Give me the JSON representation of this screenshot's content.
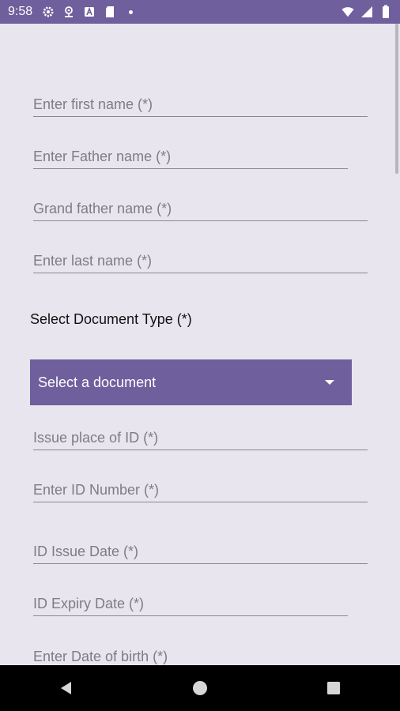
{
  "status_bar": {
    "time": "9:58",
    "left_icons": [
      "gear-icon",
      "location-icon",
      "a-box-icon",
      "sd-card-icon",
      "dot-icon"
    ],
    "right_icons": [
      "wifi-icon",
      "signal-icon",
      "battery-icon"
    ]
  },
  "form": {
    "first_name": {
      "placeholder": "Enter first name (*)",
      "value": ""
    },
    "father_name": {
      "placeholder": "Enter Father name (*)",
      "value": ""
    },
    "grandfather_name": {
      "placeholder": "Grand father name (*)",
      "value": ""
    },
    "last_name": {
      "placeholder": "Enter last name (*)",
      "value": ""
    },
    "document_type_label": "Select Document Type (*)",
    "document_type": {
      "selected": "Select a document"
    },
    "issue_place": {
      "placeholder": "Issue place of ID (*)",
      "value": ""
    },
    "id_number": {
      "placeholder": "Enter ID Number (*)",
      "value": ""
    },
    "issue_date": {
      "placeholder": "ID Issue Date (*)",
      "value": ""
    },
    "expiry_date": {
      "placeholder": "ID Expiry Date (*)",
      "value": ""
    },
    "date_of_birth": {
      "placeholder": "Enter Date of birth (*)",
      "value": ""
    }
  },
  "nav_bar": {
    "buttons": [
      "back-icon",
      "home-icon",
      "recents-icon"
    ]
  },
  "colors": {
    "primary": "#6f5f9c",
    "background": "#e8e5ef",
    "hint_text": "#7f7b87",
    "underline": "#8c8893"
  }
}
